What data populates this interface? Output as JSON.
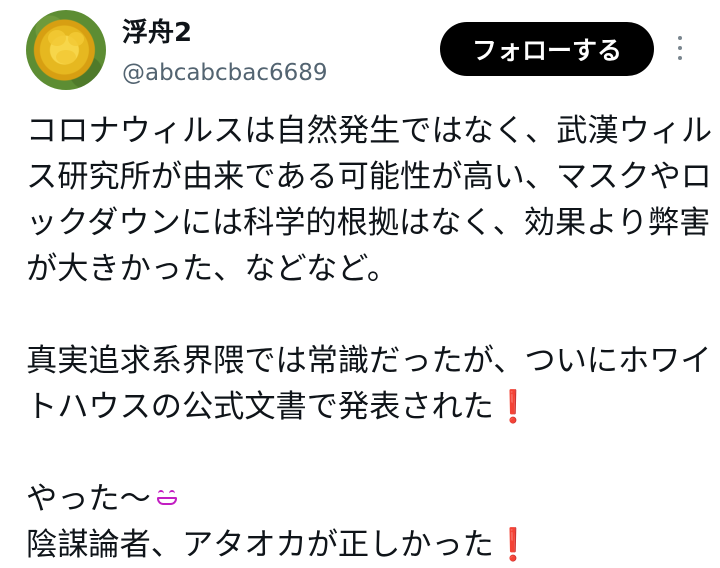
{
  "tweet": {
    "display_name": "浮舟2",
    "handle": "@abcabcbac6689",
    "follow_label": "フォローする",
    "body": {
      "p1": "コロナウィルスは自然発生ではなく、武漢ウィルス研究所が由来である可能性が高い、マスクやロックダウンには科学的根拠はなく、効果より弊害が大きかった、などなど。",
      "p2": "真実追求系界隈では常識だったが、ついにホワイトハウスの公式文書で発表された",
      "p3": "やった〜",
      "p4": "陰謀論者、アタオカが正しかった",
      "excl": "❗"
    },
    "colors": {
      "follow_bg": "#000000",
      "handle": "#536471",
      "emoji_exclamation": "#e0192b",
      "emoji_grin": "#c21ec2"
    },
    "icons": [
      "avatar-rose",
      "more-options-icon",
      "grinning-emoji-icon",
      "red-exclamation-icon"
    ]
  }
}
